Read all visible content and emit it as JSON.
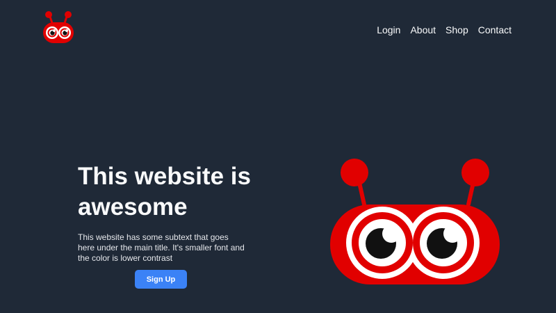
{
  "logo": {
    "icon": "red-bug-logo-icon",
    "accent": "#e10000"
  },
  "nav": {
    "items": [
      "Login",
      "About",
      "Shop",
      "Contact"
    ]
  },
  "hero": {
    "title": "This website is awesome",
    "subtext": "This website has some subtext that goes here under the main title. It's smaller font and the color is lower contrast",
    "button_label": "Sign Up",
    "image_icon": "red-bug-mascot-icon",
    "button_color": "#3b82f6",
    "background": "#1f2937"
  }
}
